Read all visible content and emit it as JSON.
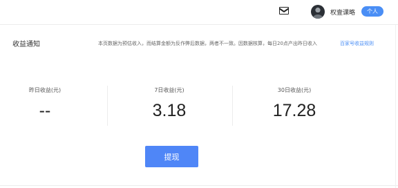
{
  "header": {
    "mail_icon": "mail-icon",
    "avatar_icon": "avatar",
    "username": "权壹课略",
    "tag": "个人"
  },
  "notice": {
    "title": "收益通知",
    "text": "本页数据为预估收入，而结算金额为反作弊后数据，两者不一致。因数据核算，每日20点产出昨日收入",
    "link": "百家号收益规则"
  },
  "stats": [
    {
      "label": "昨日收益(元)",
      "value": "--"
    },
    {
      "label": "7日收益(元)",
      "value": "3.18"
    },
    {
      "label": "30日收益(元)",
      "value": "17.28"
    }
  ],
  "actions": {
    "withdraw_label": "提现"
  },
  "colors": {
    "accent": "#4f86f7",
    "link": "#4a8ef5",
    "text": "#222222"
  }
}
